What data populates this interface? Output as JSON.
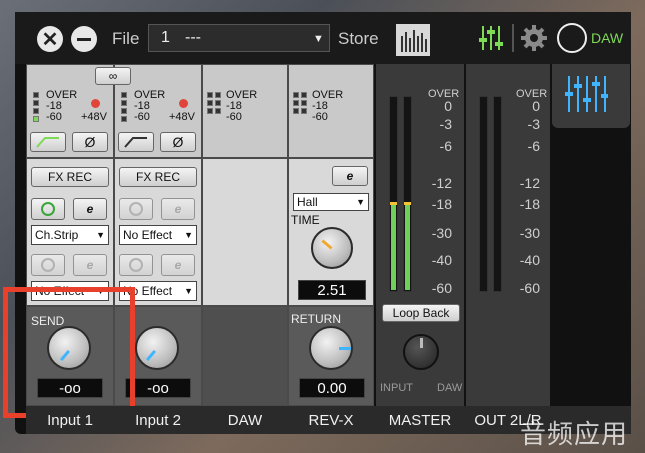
{
  "toolbar": {
    "file_label": "File",
    "preset_number": "1",
    "preset_name": "---",
    "store_label": "Store",
    "daw_label": "DAW"
  },
  "channels": [
    {
      "name": "Input 1",
      "dropdown": "Ch.Strip",
      "dropdown2": "No Effect",
      "send_label": "SEND",
      "send_value": "-oo",
      "phantom": "+48V"
    },
    {
      "name": "Input 2",
      "dropdown": "No Effect",
      "dropdown2": "No Effect",
      "send_value": "-oo",
      "phantom": "+48V"
    },
    {
      "name": "DAW"
    },
    {
      "name": "REV-X",
      "reverb_type": "Hall",
      "time_label": "TIME",
      "time_value": "2.51",
      "return_label": "RETURN",
      "return_value": "0.00"
    },
    {
      "name": "MASTER"
    },
    {
      "name": "OUT 2L/R"
    }
  ],
  "meter": {
    "over_label": "OVER",
    "minus18": "-18",
    "minus60": "-60",
    "scale": [
      "0",
      "-3",
      "-6",
      "-12",
      "-18",
      "-30",
      "-40",
      "-60"
    ]
  },
  "fx_rec_label": "FX REC",
  "loop_back_label": "Loop Back",
  "input_label": "INPUT",
  "daw_knob_label": "DAW",
  "dropdown_partial": "No Effect",
  "watermark": "音频应用",
  "colors": {
    "accent_green": "#7ed957",
    "accent_blue": "#3fb5ff",
    "highlight_red": "#e8402a"
  }
}
